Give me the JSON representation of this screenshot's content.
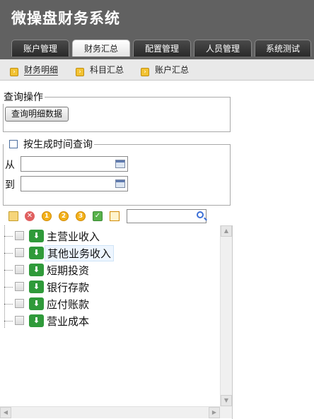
{
  "app": {
    "title": "微操盘财务系统"
  },
  "tabs": [
    {
      "label": "账户管理",
      "active": false
    },
    {
      "label": "财务汇总",
      "active": true
    },
    {
      "label": "配置管理",
      "active": false
    },
    {
      "label": "人员管理",
      "active": false
    },
    {
      "label": "系统测试",
      "active": false
    }
  ],
  "subnav": [
    {
      "label": "财务明细",
      "active": true,
      "icon": "arrow-right-icon"
    },
    {
      "label": "科目汇总",
      "active": false,
      "icon": "arrow-right-icon"
    },
    {
      "label": "账户汇总",
      "active": false,
      "icon": "arrow-right-icon"
    }
  ],
  "query_ops": {
    "legend": "查询操作",
    "button_label": "查询明细数据"
  },
  "time_query": {
    "legend": "按生成时间查询",
    "checked": false,
    "from_label": "从",
    "to_label": "到",
    "from_value": "",
    "to_value": ""
  },
  "toolbar": {
    "icons": [
      "add-folder-icon",
      "delete-icon",
      "level-1-icon",
      "level-2-icon",
      "level-3-icon",
      "check-all-icon",
      "note-icon"
    ],
    "level_labels": [
      "1",
      "2",
      "3"
    ],
    "search_value": ""
  },
  "tree": {
    "items": [
      {
        "label": "主营业收入",
        "checked": false,
        "selected": false
      },
      {
        "label": "其他业务收入",
        "checked": false,
        "selected": true
      },
      {
        "label": "短期投资",
        "checked": false,
        "selected": false
      },
      {
        "label": "银行存款",
        "checked": false,
        "selected": false
      },
      {
        "label": "应付账款",
        "checked": false,
        "selected": false
      },
      {
        "label": "营业成本",
        "checked": false,
        "selected": false
      }
    ]
  },
  "colors": {
    "header_bg": "#616161",
    "subnav_bg": "#e9e9e9",
    "accent_green": "#2f9a3a",
    "icon_yellow": "#f3b11a"
  }
}
